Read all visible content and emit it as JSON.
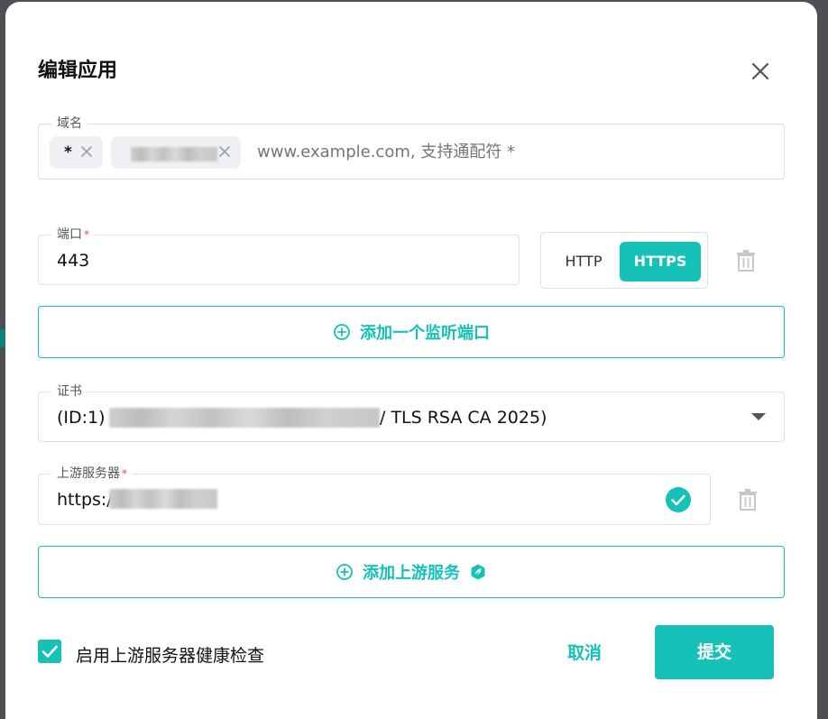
{
  "dialog": {
    "title": "编辑应用",
    "close_icon": "close-icon"
  },
  "domain": {
    "label": "域名",
    "tags": [
      {
        "text": "*"
      },
      {
        "text": ""
      }
    ],
    "placeholder": "www.example.com, 支持通配符 *"
  },
  "port": {
    "label": "端口",
    "required_mark": "*",
    "value": "443",
    "protocols": [
      "HTTP",
      "HTTPS"
    ],
    "selected_protocol": "HTTPS"
  },
  "add_port_button": {
    "label": "添加一个监听端口",
    "icon": "plus-circle-icon"
  },
  "certificate": {
    "label": "证书",
    "value_prefix": "(ID:1)",
    "value_suffix": "/ TLS RSA CA 2025)"
  },
  "upstream": {
    "label": "上游服务器",
    "required_mark": "*",
    "value_prefix": "https:/",
    "status_icon": "check-circle-icon"
  },
  "add_upstream_button": {
    "label": "添加上游服务",
    "icon": "plus-circle-icon",
    "badge_icon": "leaf-badge-icon"
  },
  "health_check": {
    "label": "启用上游服务器健康检查",
    "checked": true
  },
  "footer": {
    "cancel_label": "取消",
    "submit_label": "提交"
  },
  "colors": {
    "accent": "#16c1b8",
    "required": "#e5484d",
    "border": "#dcdfe3"
  }
}
